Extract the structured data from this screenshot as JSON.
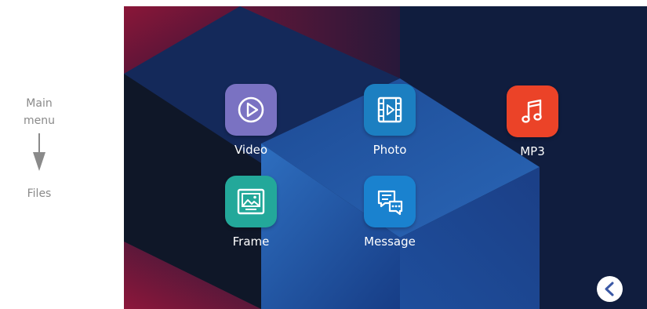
{
  "annotation": {
    "from_label": "Main\nmenu",
    "to_label": "Files"
  },
  "menu": {
    "apps": [
      {
        "label": "Video",
        "icon": "play-circle-icon",
        "color": "#7a72c2"
      },
      {
        "label": "Photo",
        "icon": "film-strip-icon",
        "color": "#1c7fc1"
      },
      {
        "label": "MP3",
        "icon": "music-note-icon",
        "color": "#eb4328"
      },
      {
        "label": "Frame",
        "icon": "picture-frame-icon",
        "color": "#23a89a"
      },
      {
        "label": "Message",
        "icon": "chat-bubbles-icon",
        "color": "#1a82cf"
      }
    ],
    "back_icon": "chevron-left-icon",
    "accent": "#3b59a6"
  }
}
